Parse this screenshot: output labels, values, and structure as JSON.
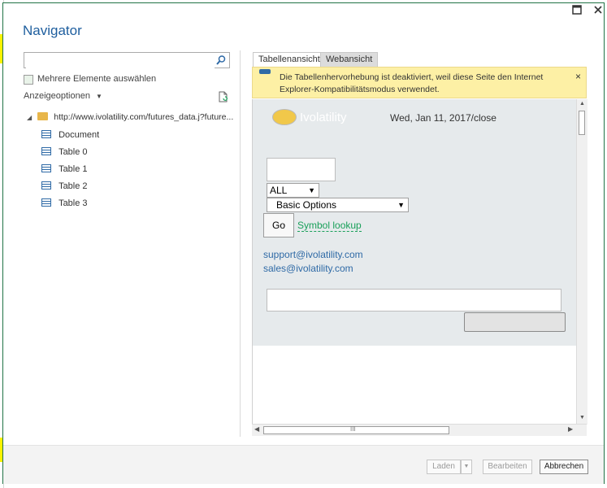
{
  "window": {
    "title": "Navigator",
    "maximize_icon": "maximize-icon",
    "close_icon": "close-icon"
  },
  "left_panel": {
    "search": {
      "value": "",
      "placeholder": "",
      "icon": "search-icon"
    },
    "multi_select_label": "Mehrere Elemente auswählen",
    "view_options_label": "Anzeigeoptionen",
    "refresh_icon": "refresh-document-icon",
    "tree": {
      "root_label": "http://www.ivolatility.com/futures_data.j?future...",
      "items": [
        {
          "label": "Document"
        },
        {
          "label": "Table 0"
        },
        {
          "label": "Table 1"
        },
        {
          "label": "Table 2"
        },
        {
          "label": "Table 3"
        }
      ]
    }
  },
  "right_panel": {
    "tabs": [
      {
        "label": "Tabellenansicht",
        "active": true
      },
      {
        "label": "Webansicht",
        "active": false
      }
    ],
    "banner": {
      "text": "Die Tabellenhervorhebung ist deaktiviert, weil diese Seite den Internet Explorer-Kompatibilitätsmodus verwendet.",
      "close": "×"
    },
    "web": {
      "logo_text": "Ivolatility",
      "date": "Wed, Jan 11, 2017/close",
      "select_all": "ALL",
      "select_options": "Basic Options",
      "go_label": "Go",
      "symbol_lookup": "Symbol lookup",
      "support_email": "support@ivolatility.com",
      "sales_email": "sales@ivolatility.com"
    },
    "hscroll_label": "III"
  },
  "footer": {
    "load_label": "Laden",
    "edit_label": "Bearbeiten",
    "cancel_label": "Abbrechen"
  },
  "colors": {
    "accent": "#217346",
    "title": "#1e5e9e",
    "banner_bg": "#fdf0a5",
    "link_green": "#1aa05a",
    "link_blue": "#2f6aa6"
  }
}
